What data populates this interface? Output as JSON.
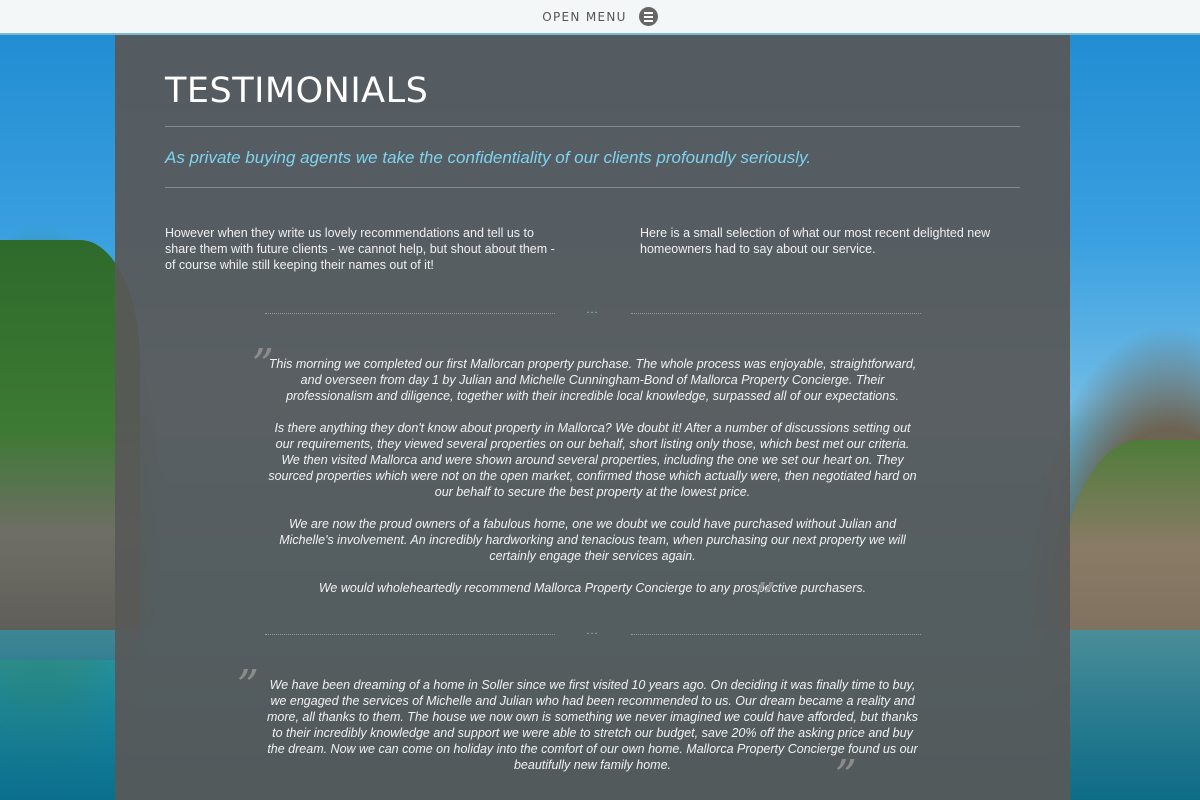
{
  "topbar": {
    "menu_label": "OPEN MENU",
    "menu_icon": "hamburger-menu-icon"
  },
  "page": {
    "title": "TESTIMONIALS",
    "intro": "As private buying agents we take the confidentiality of our clients profoundly seriously.",
    "col_left": "However when they write us lovely recommendations and tell us to share them with future clients  - we cannot help, but shout about them - of course while still keeping their names out of it!",
    "col_right": "Here is a small selection of what our most recent delighted new homeowners had to say about our service."
  },
  "divider_mark": "...",
  "testimonials": [
    {
      "paragraphs": [
        "This morning we completed our first Mallorcan property purchase. The whole process was enjoyable, straightforward, and overseen from day 1 by Julian and Michelle Cunningham-Bond of Mallorca Property Concierge. Their professionalism and diligence, together with their incredible local knowledge, surpassed all of our expectations.",
        "Is there anything they don't know about property in Mallorca? We doubt it! After a number of discussions setting out our requirements, they viewed several properties on our behalf, short listing only those, which best met our criteria. We then visited Mallorca and were shown around several properties, including the one we set our heart on. They sourced properties which were not on the open market, confirmed those which actually were, then negotiated hard on our behalf to secure the best property at the lowest price.",
        "We are now the proud owners of a fabulous home, one we doubt we could have purchased without Julian and Michelle's involvement. An incredibly hardworking and tenacious team, when purchasing our next property we will certainly engage their services again.",
        "We would wholeheartedly recommend Mallorca Property Concierge to any prospective purchasers."
      ]
    },
    {
      "paragraphs": [
        "We have been dreaming of a home in Soller since we first visited 10 years ago. On deciding it was finally time to buy, we engaged the services of Michelle and Julian who had been recommended to us. Our dream became a reality and more, all thanks to them. The house we now own is something we never imagined we could have afforded, but thanks to their incredibly knowledge and support we were able to stretch our budget, save 20% off the asking price and buy the dream. Now we can come on holiday into the comfort of our own home. Mallorca Property Concierge found us our beautifully new family home."
      ]
    }
  ],
  "quote_glyph": "”"
}
